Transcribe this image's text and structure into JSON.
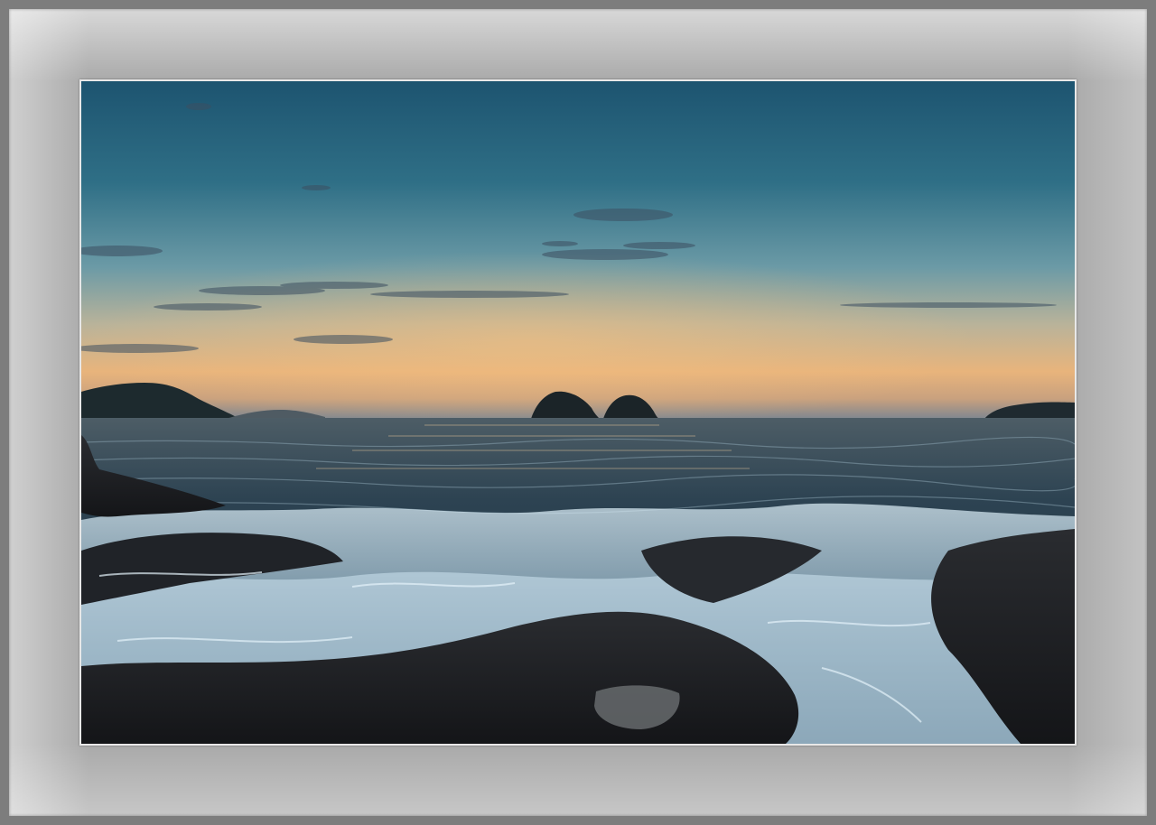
{
  "image": {
    "subject": "",
    "colors": {
      "mat": "#a9a9a9",
      "border": "#7d7d7d",
      "sky_top": "#1d5470",
      "sky_mid": "#6b9aa6",
      "horizon_glow": "#f0b878",
      "sea": "#22394a",
      "rock": "#1a1c20",
      "foam": "#cfe6f2"
    }
  }
}
